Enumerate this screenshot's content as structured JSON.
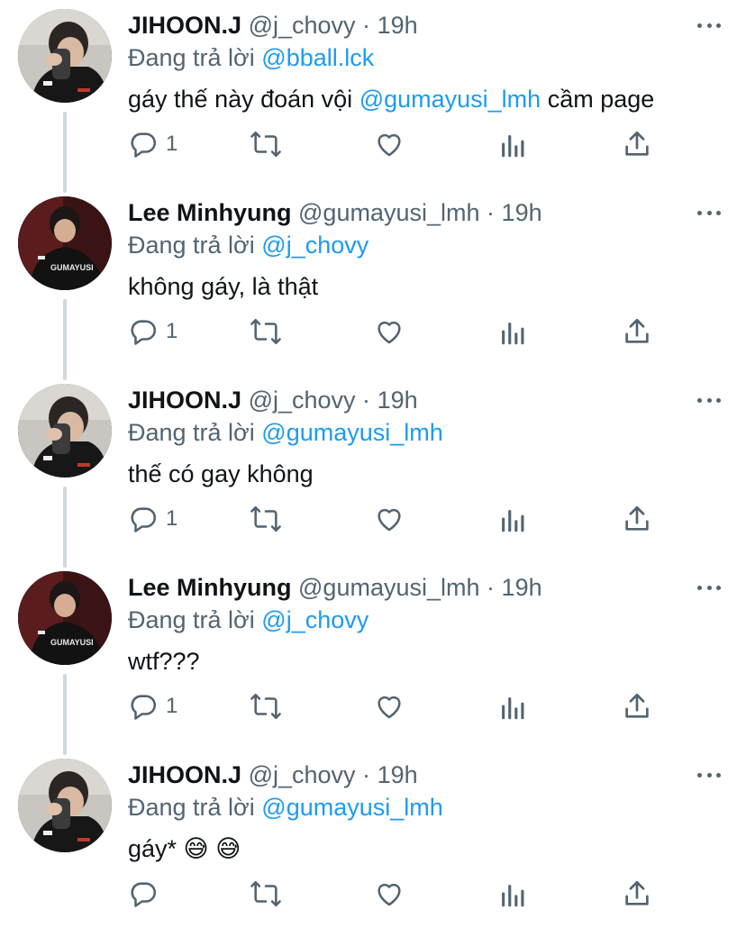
{
  "colors": {
    "accent": "#1d9bf0",
    "secondary_text": "#536471",
    "primary_text": "#0f1419",
    "thread_line": "#cfd9de"
  },
  "tweets": [
    {
      "name": "JIHOON.J",
      "handle": "@j_chovy",
      "sep": "·",
      "time": "19h",
      "reply_prefix": "Đang trả lời",
      "reply_to": "@bball.lck",
      "text_before": "gáy thế này đoán vội ",
      "text_mention": "@gumayusi_lmh",
      "text_after": " cầm page",
      "reply_count": "1",
      "avatar": "jihoon-avatar"
    },
    {
      "name": "Lee Minhyung",
      "handle": "@gumayusi_lmh",
      "sep": "·",
      "time": "19h",
      "reply_prefix": "Đang trả lời",
      "reply_to": "@j_chovy",
      "text_before": "không gáy, là thật",
      "text_mention": "",
      "text_after": "",
      "reply_count": "1",
      "avatar": "minhyung-avatar"
    },
    {
      "name": "JIHOON.J",
      "handle": "@j_chovy",
      "sep": "·",
      "time": "19h",
      "reply_prefix": "Đang trả lời",
      "reply_to": "@gumayusi_lmh",
      "text_before": "thế có gay không",
      "text_mention": "",
      "text_after": "",
      "reply_count": "1",
      "avatar": "jihoon-avatar"
    },
    {
      "name": "Lee Minhyung",
      "handle": "@gumayusi_lmh",
      "sep": "·",
      "time": "19h",
      "reply_prefix": "Đang trả lời",
      "reply_to": "@j_chovy",
      "text_before": "wtf???",
      "text_mention": "",
      "text_after": "",
      "reply_count": "1",
      "avatar": "minhyung-avatar"
    },
    {
      "name": "JIHOON.J",
      "handle": "@j_chovy",
      "sep": "·",
      "time": "19h",
      "reply_prefix": "Đang trả lời",
      "reply_to": "@gumayusi_lmh",
      "text_before": "gáy* 😅 😅",
      "text_mention": "",
      "text_after": "",
      "reply_count": "",
      "avatar": "jihoon-avatar"
    }
  ],
  "icons": {
    "reply": "reply-icon",
    "retweet": "retweet-icon",
    "like": "heart-icon",
    "analytics": "analytics-icon",
    "share": "share-icon",
    "more": "more-icon"
  }
}
